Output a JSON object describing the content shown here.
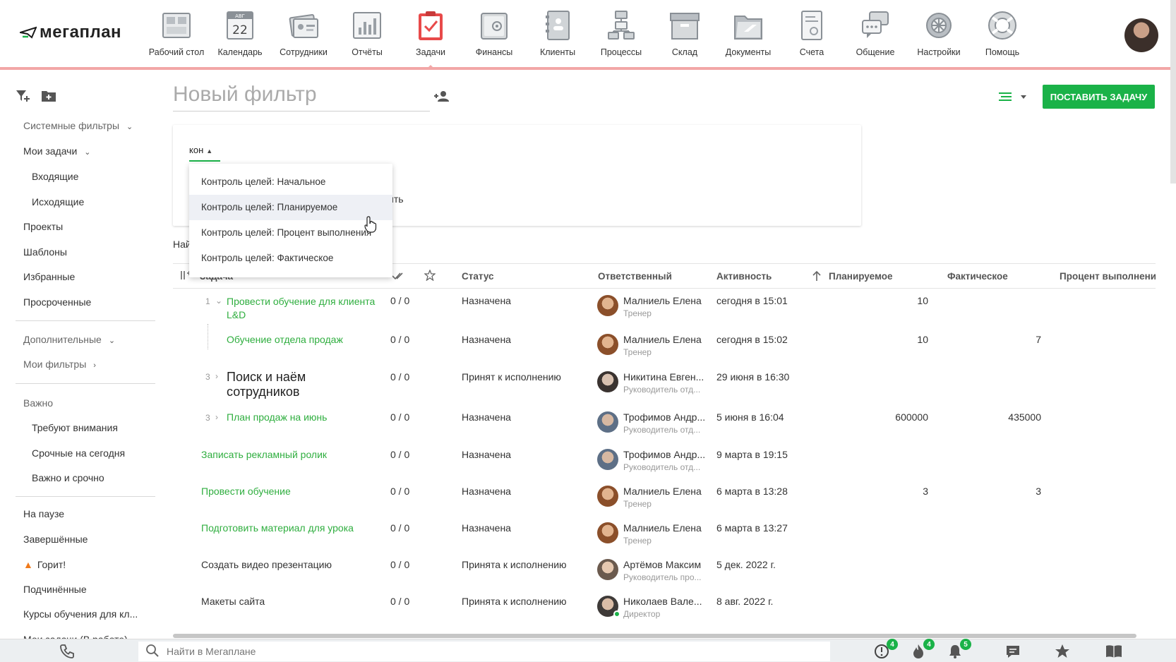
{
  "app": {
    "logo_text": "мегаплан"
  },
  "nav": {
    "items": [
      {
        "label": "Рабочий стол",
        "icon": "desktop-icon"
      },
      {
        "label": "Календарь",
        "icon": "calendar-icon",
        "calendar_month": "АВГ",
        "calendar_day": "22"
      },
      {
        "label": "Сотрудники",
        "icon": "employees-icon"
      },
      {
        "label": "Отчёты",
        "icon": "reports-icon"
      },
      {
        "label": "Задачи",
        "icon": "tasks-icon",
        "active": true
      },
      {
        "label": "Финансы",
        "icon": "finance-icon"
      },
      {
        "label": "Клиенты",
        "icon": "clients-icon"
      },
      {
        "label": "Процессы",
        "icon": "processes-icon"
      },
      {
        "label": "Склад",
        "icon": "warehouse-icon"
      },
      {
        "label": "Документы",
        "icon": "documents-icon"
      },
      {
        "label": "Счета",
        "icon": "invoices-icon"
      },
      {
        "label": "Общение",
        "icon": "communication-icon"
      },
      {
        "label": "Настройки",
        "icon": "settings-icon"
      },
      {
        "label": "Помощь",
        "icon": "help-icon"
      }
    ]
  },
  "sidebar": {
    "system_filters": "Системные фильтры",
    "my_tasks": "Мои задачи",
    "incoming": "Входящие",
    "outgoing": "Исходящие",
    "projects": "Проекты",
    "templates": "Шаблоны",
    "favorites": "Избранные",
    "overdue": "Просроченные",
    "additional": "Дополнительные",
    "my_filters": "Мои фильтры",
    "important": "Важно",
    "need_attention": "Требуют внимания",
    "urgent_today": "Срочные на сегодня",
    "important_urgent": "Важно и срочно",
    "paused": "На паузе",
    "completed": "Завершённые",
    "burning": "Горит!",
    "subordinates": "Подчинённые",
    "courses": "Курсы обучения для кл...",
    "my_tasks_work": "Мои задачи (В работе)"
  },
  "filter": {
    "title_placeholder": "Новый фильтр",
    "search_value": "кон",
    "hidden_text": "ить",
    "found_label": "Най",
    "dropdown_options": [
      "Контроль целей: Начальное",
      "Контроль целей: Планируемое",
      "Контроль целей: Процент выполнения",
      "Контроль целей: Фактическое"
    ],
    "hovered_index": 1
  },
  "toolbar": {
    "add_task_label": "ПОСТАВИТЬ ЗАДАЧУ"
  },
  "table": {
    "headers": {
      "task": "Задача",
      "status": "Статус",
      "responsible": "Ответственный",
      "activity": "Активность",
      "planned": "Планируемое",
      "actual": "Фактическое",
      "percent": "Процент выполнени"
    },
    "rows": [
      {
        "num": "1",
        "task": "Провести обучение для клиента L&D",
        "subtasks": "0 / 0",
        "status": "Назначена",
        "user": "Малниель Елена",
        "role": "Тренер",
        "activity": "сегодня в 15:01",
        "planned": "10",
        "actual": ""
      },
      {
        "num": "",
        "task": "Обучение отдела продаж",
        "subtasks": "0 / 0",
        "status": "Назначена",
        "user": "Малниель Елена",
        "role": "Тренер",
        "activity": "сегодня в 15:02",
        "planned": "10",
        "actual": "7"
      },
      {
        "num": "3",
        "task": "Поиск и наём сотрудников",
        "subtasks": "0 / 0",
        "status": "Принят к исполнению",
        "user": "Никитина Евген...",
        "role": "Руководитель отд...",
        "activity": "29 июня в 16:30",
        "planned": "",
        "actual": ""
      },
      {
        "num": "3",
        "task": "План продаж на июнь",
        "subtasks": "0 / 0",
        "status": "Назначена",
        "user": "Трофимов Андр...",
        "role": "Руководитель отд...",
        "activity": "5 июня в 16:04",
        "planned": "600000",
        "actual": "435000"
      },
      {
        "num": "",
        "task": "Записать рекламный ролик",
        "subtasks": "0 / 0",
        "status": "Назначена",
        "user": "Трофимов Андр...",
        "role": "Руководитель отд...",
        "activity": "9 марта в 19:15",
        "planned": "",
        "actual": ""
      },
      {
        "num": "",
        "task": "Провести обучение",
        "subtasks": "0 / 0",
        "status": "Назначена",
        "user": "Малниель Елена",
        "role": "Тренер",
        "activity": "6 марта в 13:28",
        "planned": "3",
        "actual": "3"
      },
      {
        "num": "",
        "task": "Подготовить материал для урока",
        "subtasks": "0 / 0",
        "status": "Назначена",
        "user": "Малниель Елена",
        "role": "Тренер",
        "activity": "6 марта в 13:27",
        "planned": "",
        "actual": ""
      },
      {
        "num": "",
        "task": "Создать видео презентацию",
        "subtasks": "0 / 0",
        "status": "Принята к исполнению",
        "user": "Артёмов Максим",
        "role": "Руководитель про...",
        "activity": "5 дек. 2022 г.",
        "planned": "",
        "actual": ""
      },
      {
        "num": "",
        "task": "Макеты сайта",
        "subtasks": "0 / 0",
        "status": "Принята к исполнению",
        "user": "Николаев Вале...",
        "role": "Директор",
        "activity": "8 авг. 2022 г.",
        "planned": "",
        "actual": ""
      }
    ]
  },
  "bottom": {
    "search_placeholder": "Найти в Мегаплане",
    "alerts_badge": "4",
    "fire_badge": "4",
    "notifications_badge": "5"
  },
  "colors": {
    "accent": "#1ab248",
    "link": "#2fae3f",
    "nav_border": "#f2a7a7"
  }
}
